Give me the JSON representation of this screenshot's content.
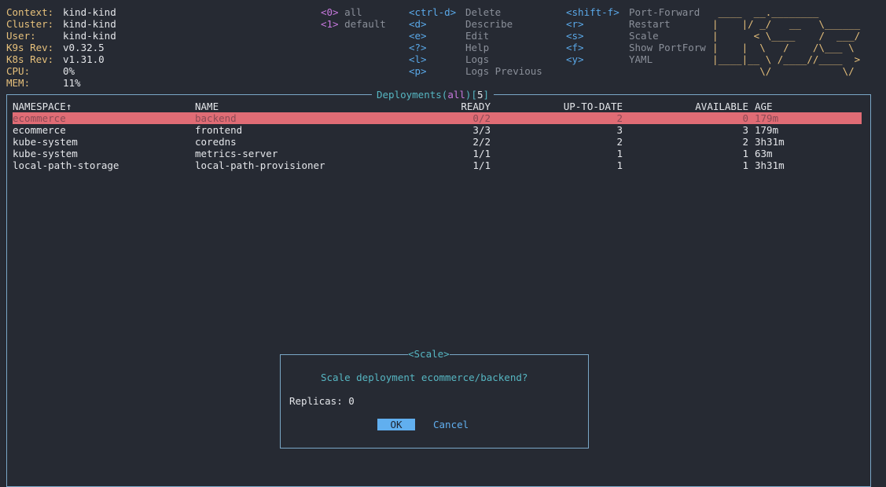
{
  "info": [
    {
      "label": "Context:",
      "value": "kind-kind"
    },
    {
      "label": "Cluster:",
      "value": "kind-kind"
    },
    {
      "label": "User:",
      "value": "kind-kind"
    },
    {
      "label": "K9s Rev:",
      "value": "v0.32.5"
    },
    {
      "label": "K8s Rev:",
      "value": "v1.31.0"
    },
    {
      "label": "CPU:",
      "value": "0%"
    },
    {
      "label": "MEM:",
      "value": "11%"
    }
  ],
  "namespaces": [
    {
      "key": "<0>",
      "label": "all"
    },
    {
      "key": "<1>",
      "label": "default"
    }
  ],
  "hotkeys_col1": [
    {
      "key": "<ctrl-d>",
      "label": "Delete"
    },
    {
      "key": "<d>",
      "label": "Describe"
    },
    {
      "key": "<e>",
      "label": "Edit"
    },
    {
      "key": "<?>",
      "label": "Help"
    },
    {
      "key": "<l>",
      "label": "Logs"
    },
    {
      "key": "<p>",
      "label": "Logs Previous"
    }
  ],
  "hotkeys_col2": [
    {
      "key": "<shift-f>",
      "label": "Port-Forward"
    },
    {
      "key": "<r>",
      "label": "Restart"
    },
    {
      "key": "<s>",
      "label": "Scale"
    },
    {
      "key": "<f>",
      "label": "Show PortForw"
    },
    {
      "key": "<y>",
      "label": "YAML"
    }
  ],
  "logo": " ____  __.________       \n|    |/ _/   __   \\______\n|      < \\____    /  ___/\n|    |  \\   /    /\\___ \\ \n|____|__ \\ /____//____  >\n        \\/            \\/ ",
  "table": {
    "title_prefix": "Deployments(",
    "title_ns": "all",
    "title_mid": ")[",
    "title_count": "5",
    "title_suffix": "]",
    "headers": {
      "namespace": "NAMESPACE↑",
      "name": "NAME",
      "ready": "READY",
      "uptodate": "UP-TO-DATE",
      "available": "AVAILABLE",
      "age": "AGE"
    },
    "rows": [
      {
        "namespace": "ecommerce",
        "name": "backend",
        "ready": "0/2",
        "uptodate": "2",
        "available": "0",
        "age": "179m"
      },
      {
        "namespace": "ecommerce",
        "name": "frontend",
        "ready": "3/3",
        "uptodate": "3",
        "available": "3",
        "age": "179m"
      },
      {
        "namespace": "kube-system",
        "name": "coredns",
        "ready": "2/2",
        "uptodate": "2",
        "available": "2",
        "age": "3h31m"
      },
      {
        "namespace": "kube-system",
        "name": "metrics-server",
        "ready": "1/1",
        "uptodate": "1",
        "available": "1",
        "age": "63m"
      },
      {
        "namespace": "local-path-storage",
        "name": "local-path-provisioner",
        "ready": "1/1",
        "uptodate": "1",
        "available": "1",
        "age": "3h31m"
      }
    ]
  },
  "dialog": {
    "title": "<Scale>",
    "question": "Scale deployment ecommerce/backend?",
    "replicas_label": "Replicas:",
    "replicas_value": "0",
    "ok": "OK",
    "cancel": "Cancel"
  },
  "colors": {
    "background": "#262a33",
    "selected_row": "#e06c75",
    "accent": "#56b6c2",
    "key": "#5aa8e8",
    "label": "#e6c07b"
  }
}
